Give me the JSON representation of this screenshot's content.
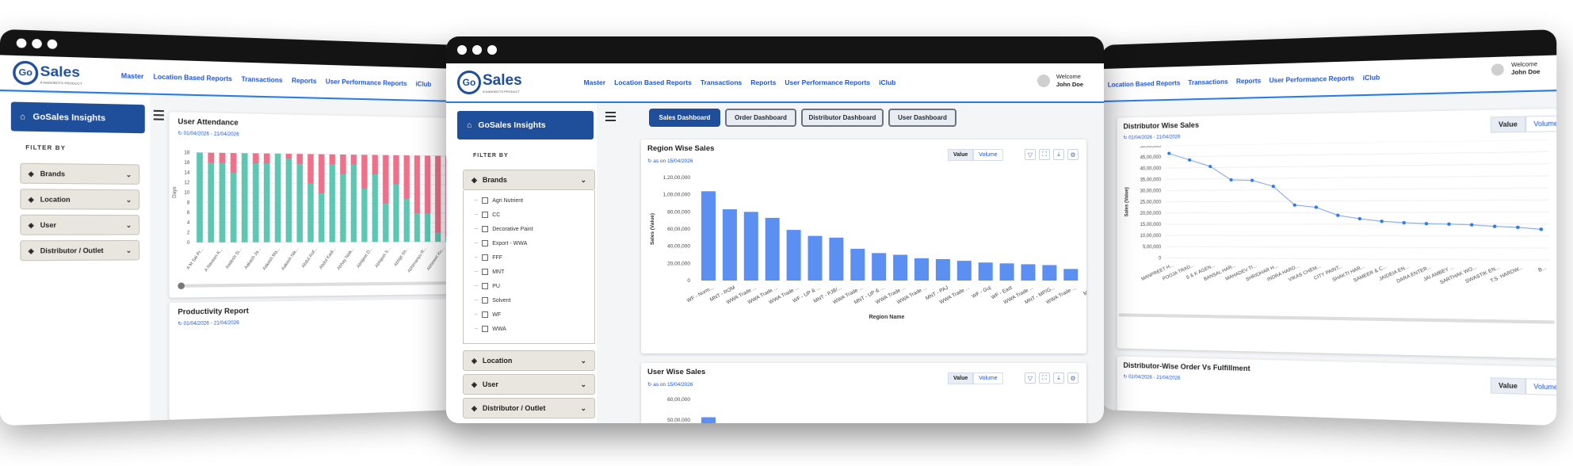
{
  "brand": {
    "logo_mark": "Go",
    "logo_text": "Sales",
    "logo_sub": "A NANOBOTS PRODUCT"
  },
  "menu": [
    "Master",
    "Location Based Reports",
    "Transactions",
    "Reports",
    "User Performance Reports",
    "iClub"
  ],
  "user": {
    "welcome": "Welcome",
    "name": "John Doe"
  },
  "sidebar": {
    "title": "GoSales Insights",
    "filter_by": "FILTER BY",
    "sections": [
      "Brands",
      "Location",
      "User",
      "Distributor / Outlet"
    ],
    "brands": [
      "Agri Nutrient",
      "CC",
      "Decorative Paint",
      "Export - WWA",
      "FFF",
      "MNT",
      "PU",
      "Solvent",
      "WF",
      "WWA"
    ]
  },
  "dashboards": [
    "Sales Dashboard",
    "Order Dashboard",
    "Distributor Dashboard",
    "User Dashboard"
  ],
  "toggle": {
    "value": "Value",
    "volume": "Volume"
  },
  "icons": [
    "filter-icon",
    "expand-icon",
    "download-icon",
    "settings-icon",
    "home-icon",
    "refresh-icon",
    "user-icon",
    "layers-icon",
    "menu-icon"
  ],
  "colors": {
    "primary": "#1f4e9a",
    "accent": "#2c7be5",
    "bar": "#5b8ff2",
    "teal": "#5ec7b4",
    "pink": "#f0708a"
  },
  "left_window": {
    "attendance": {
      "title": "User Attendance",
      "date": "01/04/2026 - 21/04/2026",
      "ylabel": "Days"
    },
    "productivity": {
      "title": "Productivity Report",
      "date": "01/04/2026 - 21/04/2026"
    }
  },
  "center_window": {
    "region_card": {
      "title": "Region Wise Sales",
      "subtitle": "as on 15/04/2026"
    },
    "user_card": {
      "title": "User Wise Sales",
      "subtitle": "as on 15/04/2026"
    }
  },
  "right_window": {
    "dist_card": {
      "title": "Distributor Wise Sales",
      "date": "01/04/2026 - 21/04/2026"
    },
    "fulfil_card": {
      "title": "Distributor-Wise Order Vs Fulfillment",
      "date": "01/04/2026 - 21/04/2026"
    }
  },
  "chart_data": [
    {
      "type": "bar",
      "title": "User Attendance",
      "ylabel": "Days",
      "ylim": [
        0,
        18
      ],
      "yticks": [
        "0",
        "2",
        "4",
        "6",
        "8",
        "10",
        "12",
        "14",
        "16",
        "18"
      ],
      "categories": [
        "A M Sai Pr...",
        "A Naveen K...",
        "Aadesh Si...",
        "Aakash Ja...",
        "Aakash Ma...",
        "Aakash Nik...",
        "Abdul Asif...",
        "Abdul Kadi...",
        "Abhay Naik...",
        "Abhijeet D...",
        "Abhijeet S...",
        "Abhijit Sh...",
        "Abhimanyu R...",
        "Abhineet Ku..."
      ],
      "series": [
        {
          "values": [
            18,
            16,
            16,
            14,
            18,
            16,
            16,
            18,
            17,
            16,
            12,
            10,
            16,
            14,
            16,
            11,
            14,
            8,
            12,
            9,
            6,
            6,
            2,
            1
          ]
        },
        {
          "values": [
            0,
            2,
            2,
            4,
            0,
            2,
            2,
            0,
            1,
            2,
            6,
            8,
            2,
            4,
            2,
            7,
            4,
            10,
            6,
            9,
            12,
            12,
            16,
            17
          ]
        }
      ]
    },
    {
      "type": "bar",
      "title": "Region Wise Sales",
      "xlabel": "Region Name",
      "ylabel": "Sales (Value)",
      "ylim": [
        0,
        12000000
      ],
      "yticks": [
        "0",
        "20,00,000",
        "40,00,000",
        "60,00,000",
        "80,00,000",
        "1,00,00,000",
        "1,20,00,000"
      ],
      "categories": [
        "WF - Norm...",
        "MNT - ROM",
        "WWA Trade ...",
        "WWA Trade ...",
        "WWA Trade ...",
        "WF - UP & ...",
        "MNT - PJB/...",
        "WWA Trade ...",
        "MNT - UP & ...",
        "WWA Trade ...",
        "WWA Trade ...",
        "MNT - PAJ",
        "WWA Trade ...",
        "WF - Guj",
        "WF - East",
        "WWA Trade ...",
        "MNT - MP/G...",
        "WWA Trade ...",
        "MNT..."
      ],
      "values": [
        10400000,
        8300000,
        8000000,
        7300000,
        5900000,
        5200000,
        5000000,
        3700000,
        3200000,
        3000000,
        2600000,
        2500000,
        2300000,
        2100000,
        2000000,
        1900000,
        1800000,
        1350000
      ]
    },
    {
      "type": "bar",
      "title": "User Wise Sales",
      "ylim": [
        0,
        6000000
      ],
      "yticks": [
        "60,00,000",
        "50,00,000"
      ],
      "values": [
        5100000
      ]
    },
    {
      "type": "line",
      "title": "Distributor Wise Sales",
      "ylabel": "Sales (Value)",
      "ylim": [
        0,
        5000000
      ],
      "yticks": [
        "0",
        "5,00,000",
        "10,00,000",
        "15,00,000",
        "20,00,000",
        "25,00,000",
        "30,00,000",
        "35,00,000",
        "40,00,000",
        "45,00,000",
        "50,00,000"
      ],
      "categories": [
        "MANPREET H...",
        "POOJA TRAD...",
        "S & K AGEN...",
        "BANSAL HAR...",
        "MAHADEV TI...",
        "SHRIDHAR H...",
        "INDRA HARD...",
        "VIKAS CHEM...",
        "CITY PAINT...",
        "SHAKTI HAR...",
        "SAMEER & C...",
        "JAIDEIA EN...",
        "DARA ENTER...",
        "JAI AMBEY ...",
        "SARTHAK WO...",
        "SWASTIK EN...",
        "T.S. HARDW...",
        "B..."
      ],
      "values": [
        4650000,
        4350000,
        4050000,
        3450000,
        3420000,
        3150000,
        2330000,
        2230000,
        1880000,
        1730000,
        1620000,
        1560000,
        1520000,
        1500000,
        1470000,
        1400000,
        1360000,
        1280000
      ]
    }
  ]
}
